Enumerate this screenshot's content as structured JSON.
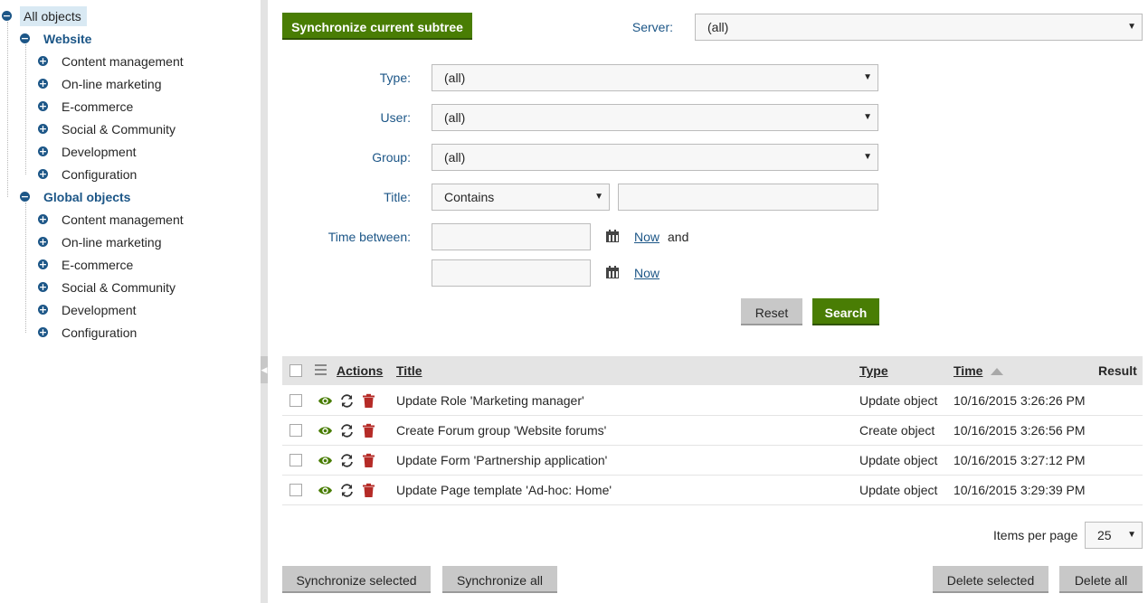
{
  "tree": {
    "root": "All objects",
    "groups": [
      {
        "label": "Website",
        "items": [
          "Content management",
          "On-line marketing",
          "E-commerce",
          "Social & Community",
          "Development",
          "Configuration"
        ]
      },
      {
        "label": "Global objects",
        "items": [
          "Content management",
          "On-line marketing",
          "E-commerce",
          "Social & Community",
          "Development",
          "Configuration"
        ]
      }
    ]
  },
  "toolbar": {
    "sync_subtree_label": "Synchronize current subtree",
    "server_label": "Server:",
    "server_value": "(all)"
  },
  "filter": {
    "type_label": "Type:",
    "type_value": "(all)",
    "user_label": "User:",
    "user_value": "(all)",
    "group_label": "Group:",
    "group_value": "(all)",
    "title_label": "Title:",
    "title_operator": "Contains",
    "title_value": "",
    "time_label": "Time between:",
    "time_from": "",
    "time_to": "",
    "now_label": "Now",
    "and_label": "and",
    "reset_label": "Reset",
    "search_label": "Search"
  },
  "grid": {
    "headers": {
      "actions": "Actions",
      "title": "Title",
      "type": "Type",
      "time": "Time",
      "result": "Result"
    },
    "rows": [
      {
        "title": "Update Role 'Marketing manager'",
        "type": "Update object",
        "time": "10/16/2015 3:26:26 PM",
        "result": ""
      },
      {
        "title": "Create Forum group 'Website forums'",
        "type": "Create object",
        "time": "10/16/2015 3:26:56 PM",
        "result": ""
      },
      {
        "title": "Update Form 'Partnership application'",
        "type": "Update object",
        "time": "10/16/2015 3:27:12 PM",
        "result": ""
      },
      {
        "title": "Update Page template 'Ad-hoc: Home'",
        "type": "Update object",
        "time": "10/16/2015 3:29:39 PM",
        "result": ""
      }
    ],
    "icons": {
      "view": "eye-icon",
      "sync": "sync-icon",
      "delete": "trash-icon"
    }
  },
  "pager": {
    "items_per_page_label": "Items per page",
    "items_per_page_value": "25"
  },
  "footer": {
    "sync_selected_label": "Synchronize selected",
    "sync_all_label": "Synchronize all",
    "delete_selected_label": "Delete selected",
    "delete_all_label": "Delete all"
  },
  "colors": {
    "accent_green": "#497d04",
    "link_blue": "#1c5687",
    "delete_red": "#b52b27",
    "header_gray": "#e4e4e4"
  }
}
